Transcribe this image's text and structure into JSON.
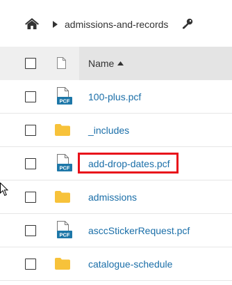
{
  "breadcrumb": {
    "home_icon": "home-icon",
    "current": "admissions-and-records",
    "access_icon": "key-icon"
  },
  "table": {
    "header": {
      "name_label": "Name",
      "sort": "ascending"
    },
    "rows": [
      {
        "name": "100-plus.pcf",
        "type": "pcf"
      },
      {
        "name": "_includes",
        "type": "folder"
      },
      {
        "name": "add-drop-dates.pcf",
        "type": "pcf",
        "highlighted": true
      },
      {
        "name": "admissions",
        "type": "folder"
      },
      {
        "name": "asccStickerRequest.pcf",
        "type": "pcf"
      },
      {
        "name": "catalogue-schedule",
        "type": "folder"
      }
    ]
  },
  "badges": {
    "pcf": "PCF"
  },
  "colors": {
    "link": "#1a6ea8",
    "folder": "#f7c23a",
    "pcf_badge": "#1d77a8",
    "highlight": "#e8101a",
    "header_bg": "#efefef",
    "name_header_bg": "#e4e4e4"
  }
}
